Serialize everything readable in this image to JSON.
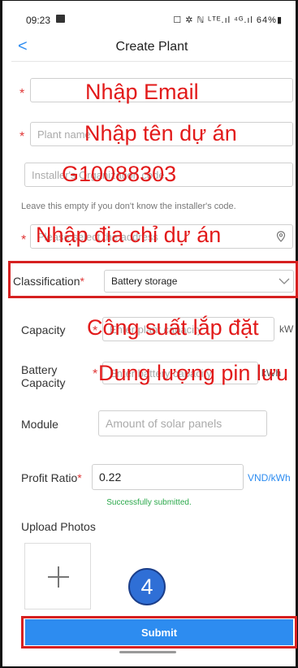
{
  "statusbar": {
    "time": "09:23",
    "right": "☐ ✲ ℕ ᴸᵀᴱ.ıl ⁴ᴳ.ıl 64%▮"
  },
  "topbar": {
    "back": "<",
    "title": "Create Plant"
  },
  "fields": {
    "email": {
      "value": ""
    },
    "plant_name": {
      "placeholder": "Plant name"
    },
    "installer_code": {
      "placeholder": "Installer's Organization code"
    },
    "installer_hint": "Leave this empty if you don't know the installer's code.",
    "address": {
      "placeholder": "Please select the address"
    },
    "classification": {
      "label": "Classification",
      "value": "Battery storage"
    },
    "capacity": {
      "label": "Capacity",
      "placeholder": "Enter plant capacity",
      "unit": "kW"
    },
    "battery_capacity": {
      "label1": "Battery",
      "label2": "Capacity",
      "placeholder": "Enter battery capacity",
      "unit": "kWh"
    },
    "module": {
      "label": "Module",
      "placeholder": "Amount of solar panels"
    },
    "profit_ratio": {
      "label": "Profit Ratio",
      "value": "0.22",
      "unit": "VND/kWh"
    }
  },
  "success_msg": "Successfully submitted.",
  "upload": {
    "label": "Upload Photos"
  },
  "step_badge": "4",
  "submit_label": "Submit",
  "annotations": {
    "email": "Nhập Email",
    "plant_name": "Nhập tên dự án",
    "code": "G10088303",
    "address": "Nhập địa chỉ dự án",
    "capacity": "Công suất lắp đặt",
    "battery": "Dung lượng pin lưu"
  },
  "colors": {
    "accent": "#2d8cf0",
    "annotation_red": "#e21a1a",
    "required_red": "#e03636",
    "success_green": "#2aa84a",
    "badge_blue": "#2f6fd6"
  }
}
